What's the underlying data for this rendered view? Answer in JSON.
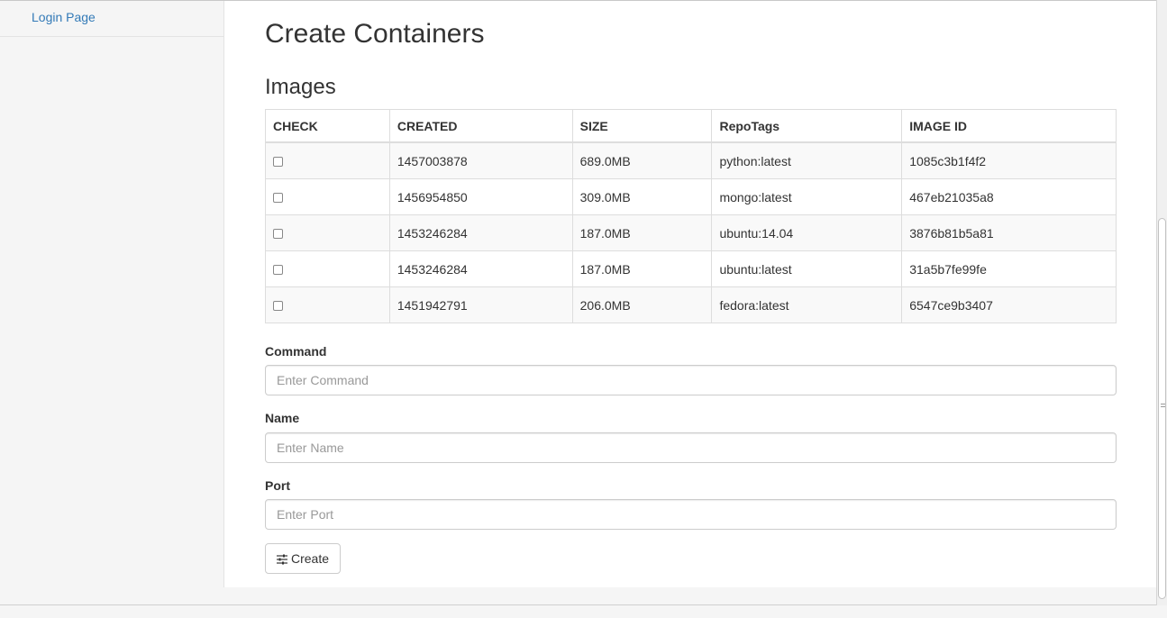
{
  "sidebar": {
    "items": [
      {
        "label": "Login Page"
      }
    ]
  },
  "main": {
    "title": "Create Containers",
    "images_section_title": "Images"
  },
  "table": {
    "headers": [
      "CHECK",
      "CREATED",
      "SIZE",
      "RepoTags",
      "IMAGE ID"
    ],
    "rows": [
      {
        "checked": false,
        "created": "1457003878",
        "size": "689.0MB",
        "repotags": "python:latest",
        "image_id": "1085c3b1f4f2"
      },
      {
        "checked": false,
        "created": "1456954850",
        "size": "309.0MB",
        "repotags": "mongo:latest",
        "image_id": "467eb21035a8"
      },
      {
        "checked": false,
        "created": "1453246284",
        "size": "187.0MB",
        "repotags": "ubuntu:14.04",
        "image_id": "3876b81b5a81"
      },
      {
        "checked": false,
        "created": "1453246284",
        "size": "187.0MB",
        "repotags": "ubuntu:latest",
        "image_id": "31a5b7fe99fe"
      },
      {
        "checked": false,
        "created": "1451942791",
        "size": "206.0MB",
        "repotags": "fedora:latest",
        "image_id": "6547ce9b3407"
      }
    ]
  },
  "form": {
    "command": {
      "label": "Command",
      "placeholder": "Enter Command",
      "value": ""
    },
    "name": {
      "label": "Name",
      "placeholder": "Enter Name",
      "value": ""
    },
    "port": {
      "label": "Port",
      "placeholder": "Enter Port",
      "value": ""
    },
    "create_button": {
      "label": "Create",
      "icon": "sliders-icon"
    }
  },
  "colors": {
    "link": "#337ab7",
    "sidebar_bg": "#f5f5f5",
    "table_stripe": "#f9f9f9",
    "border": "#dddddd"
  }
}
